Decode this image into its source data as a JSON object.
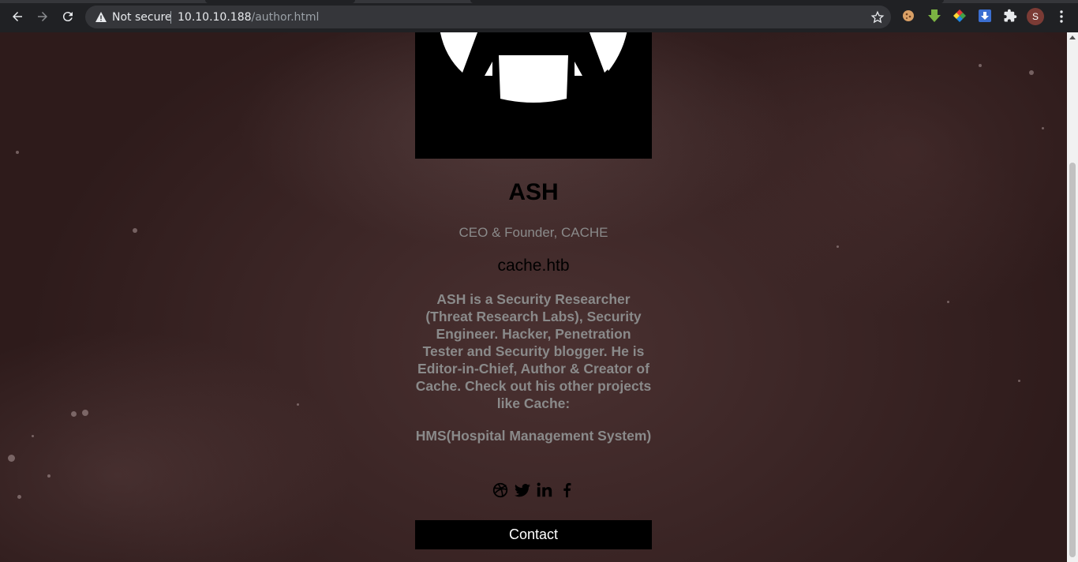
{
  "browser": {
    "security_label": "Not secure",
    "url_host": "10.10.10.188",
    "url_path": "/author.html",
    "profile_initial": "S"
  },
  "author": {
    "name": "ASH",
    "role": "CEO & Founder, CACHE",
    "site": "cache.htb",
    "bio": "ASH is a Security Researcher (Threat Research Labs), Security Engineer. Hacker, Penetration Tester and Security blogger. He is Editor-in-Chief, Author & Creator of Cache. Check out his other projects like Cache:",
    "projects": "HMS(Hospital Management System)",
    "contact_label": "Contact"
  },
  "socials": [
    "dribbble-icon",
    "twitter-icon",
    "linkedin-icon",
    "facebook-icon"
  ]
}
